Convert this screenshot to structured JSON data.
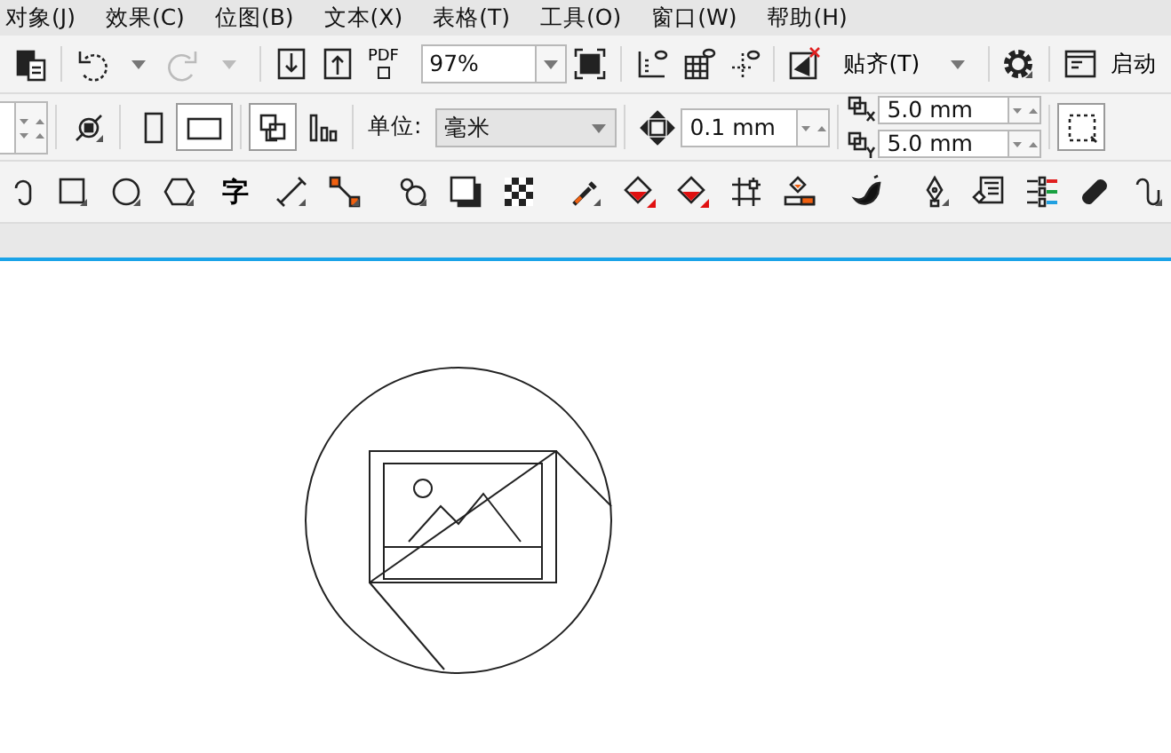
{
  "menu_bar": [
    {
      "label": "对象(J)"
    },
    {
      "label": "效果(C)"
    },
    {
      "label": "位图(B)"
    },
    {
      "label": "文本(X)"
    },
    {
      "label": "表格(T)"
    },
    {
      "label": "工具(O)"
    },
    {
      "label": "窗口(W)"
    },
    {
      "label": "帮助(H)"
    }
  ],
  "standard_toolbar": {
    "pdf_label": "PDF",
    "zoom_level": "97%",
    "snap_button": "贴齐(T)",
    "launch_button": "启动"
  },
  "property_bar": {
    "units_label": "单位:",
    "units_value": "毫米",
    "nudge_distance": "0.1 mm",
    "duplicate_x": "5.0 mm",
    "duplicate_y": "5.0 mm",
    "page_orientation": [
      {
        "kind": "portrait",
        "selected": false
      },
      {
        "kind": "landscape",
        "selected": true
      }
    ],
    "all_pages_selected": true
  },
  "toolbox": {
    "text_tool": "字"
  }
}
